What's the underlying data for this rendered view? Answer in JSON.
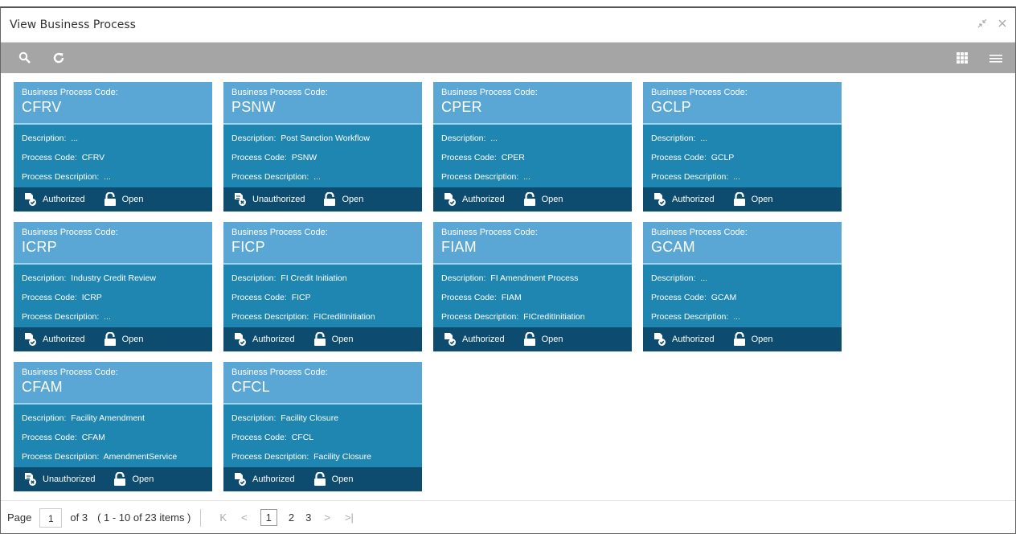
{
  "window": {
    "title": "View Business Process"
  },
  "card_labels": {
    "bp_code": "Business Process Code:",
    "description": "Description:",
    "process_code": "Process Code:",
    "process_description": "Process Description:"
  },
  "cards": [
    {
      "code": "CFRV",
      "description": "...",
      "process_code": "CFRV",
      "process_description": "...",
      "status": "Authorized",
      "lock": "Open"
    },
    {
      "code": "PSNW",
      "description": "Post Sanction Workflow",
      "process_code": "PSNW",
      "process_description": "...",
      "status": "Unauthorized",
      "lock": "Open"
    },
    {
      "code": "CPER",
      "description": "...",
      "process_code": "CPER",
      "process_description": "...",
      "status": "Authorized",
      "lock": "Open"
    },
    {
      "code": "GCLP",
      "description": "...",
      "process_code": "GCLP",
      "process_description": "...",
      "status": "Authorized",
      "lock": "Open"
    },
    {
      "code": "ICRP",
      "description": "Industry Credit Review",
      "process_code": "ICRP",
      "process_description": "...",
      "status": "Authorized",
      "lock": "Open"
    },
    {
      "code": "FICP",
      "description": "FI Credit Initiation",
      "process_code": "FICP",
      "process_description": "FICreditInitiation",
      "status": "Authorized",
      "lock": "Open"
    },
    {
      "code": "FIAM",
      "description": "FI Amendment Process",
      "process_code": "FIAM",
      "process_description": "FICreditInitiation",
      "status": "Authorized",
      "lock": "Open"
    },
    {
      "code": "GCAM",
      "description": "...",
      "process_code": "GCAM",
      "process_description": "...",
      "status": "Authorized",
      "lock": "Open"
    },
    {
      "code": "CFAM",
      "description": "Facility Amendment",
      "process_code": "CFAM",
      "process_description": "AmendmentService",
      "status": "Unauthorized",
      "lock": "Open"
    },
    {
      "code": "CFCL",
      "description": "Facility Closure",
      "process_code": "CFCL",
      "process_description": "Facility Closure",
      "status": "Authorized",
      "lock": "Open"
    }
  ],
  "pager": {
    "page_label": "Page",
    "current_page": "1",
    "of_text": "of 3",
    "items_text": "( 1 - 10 of 23 items )",
    "pages": [
      "1",
      "2",
      "3"
    ],
    "first": "K",
    "prev": "<",
    "next": ">",
    "last": ">|"
  },
  "icons": {
    "search": "search-icon",
    "refresh": "refresh-icon",
    "grid": "grid-view-icon",
    "list": "list-view-icon",
    "minimize": "minimize-icon",
    "close": "close-icon"
  },
  "colors": {
    "toolbar": "#a5a5a5",
    "card_body": "#1f86b2",
    "card_head": "#5aa6d4",
    "card_foot": "#0d4b6f"
  }
}
